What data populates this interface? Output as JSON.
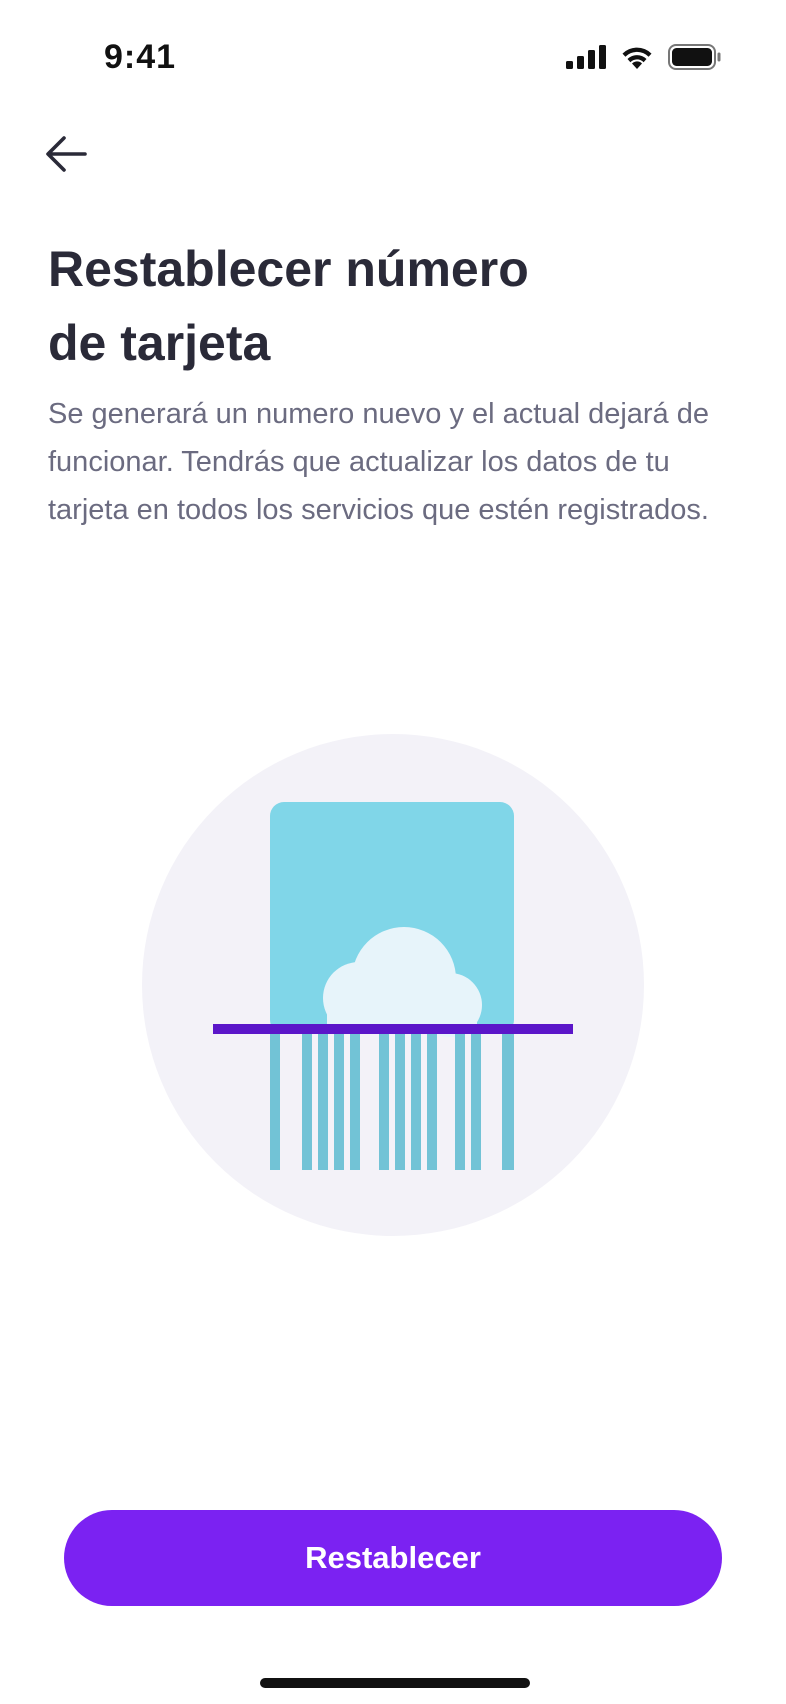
{
  "status_bar": {
    "time": "9:41",
    "icons": [
      "cellular-signal-icon",
      "wifi-icon",
      "battery-icon"
    ]
  },
  "nav": {
    "back_icon": "arrow-left-icon"
  },
  "content": {
    "title_line1": "Restablecer número",
    "title_line2": "de tarjeta",
    "description": "Se generará un numero nuevo y el actual dejará de funcionar. Tendrás que actualizar los datos de tu tarjeta en todos los servicios que estén registrados."
  },
  "illustration": {
    "name": "card-shredder-illustration",
    "colors": {
      "circle": "#f3f2f8",
      "card": "#80d6e8",
      "cloud": "#e7f4fa",
      "shredder_slot": "#5b16c9",
      "strips": "#72c3d6"
    }
  },
  "actions": {
    "primary_label": "Restablecer",
    "primary_color": "#7b22f2"
  }
}
